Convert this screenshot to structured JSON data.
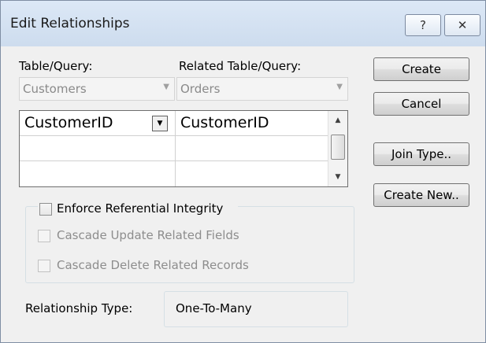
{
  "window": {
    "title": "Edit Relationships",
    "help_glyph": "?",
    "close_glyph": "✕"
  },
  "labels": {
    "table_query": "Table/Query:",
    "related_table_query": "Related Table/Query:"
  },
  "combos": {
    "table": "Customers",
    "related_table": "Orders"
  },
  "fields_grid": {
    "rows": [
      [
        "CustomerID",
        "CustomerID"
      ],
      [
        "",
        ""
      ],
      [
        "",
        ""
      ]
    ]
  },
  "options": {
    "enforce_ri": "Enforce Referential Integrity",
    "cascade_update": "Cascade Update Related Fields",
    "cascade_delete": "Cascade Delete Related Records"
  },
  "relationship": {
    "label": "Relationship Type:",
    "value": "One-To-Many"
  },
  "buttons": {
    "create": "Create",
    "cancel": "Cancel",
    "join_type": "Join Type..",
    "create_new": "Create New.."
  }
}
